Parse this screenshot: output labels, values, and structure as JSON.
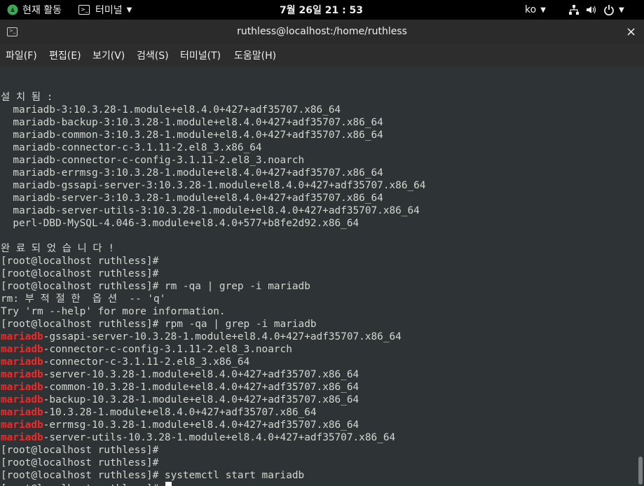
{
  "topbar": {
    "activities": "현재 활동",
    "app_name": "터미널",
    "clock": "7월 26일  21 : 53",
    "language": "ko"
  },
  "window": {
    "title": "ruthless@localhost:/home/ruthless",
    "close": "×"
  },
  "menu": [
    "파일(F)",
    "편집(E)",
    "보기(V)",
    "검색(S)",
    "터미널(T)",
    "도움말(H)"
  ],
  "terminal_lines": [
    {
      "text": ""
    },
    {
      "text": "설 치 됨 :"
    },
    {
      "text": "  mariadb-3:10.3.28-1.module+el8.4.0+427+adf35707.x86_64"
    },
    {
      "text": "  mariadb-backup-3:10.3.28-1.module+el8.4.0+427+adf35707.x86_64"
    },
    {
      "text": "  mariadb-common-3:10.3.28-1.module+el8.4.0+427+adf35707.x86_64"
    },
    {
      "text": "  mariadb-connector-c-3.1.11-2.el8_3.x86_64"
    },
    {
      "text": "  mariadb-connector-c-config-3.1.11-2.el8_3.noarch"
    },
    {
      "text": "  mariadb-errmsg-3:10.3.28-1.module+el8.4.0+427+adf35707.x86_64"
    },
    {
      "text": "  mariadb-gssapi-server-3:10.3.28-1.module+el8.4.0+427+adf35707.x86_64"
    },
    {
      "text": "  mariadb-server-3:10.3.28-1.module+el8.4.0+427+adf35707.x86_64"
    },
    {
      "text": "  mariadb-server-utils-3:10.3.28-1.module+el8.4.0+427+adf35707.x86_64"
    },
    {
      "text": "  perl-DBD-MySQL-4.046-3.module+el8.4.0+577+b8fe2d92.x86_64"
    },
    {
      "text": ""
    },
    {
      "text": "완 료 되 었 습 니 다 !"
    },
    {
      "text": "[root@localhost ruthless]#"
    },
    {
      "text": "[root@localhost ruthless]#"
    },
    {
      "text": "[root@localhost ruthless]# rm -qa | grep -i mariadb"
    },
    {
      "text": "rm: 부 적 절 한  옵 션  -- 'q'"
    },
    {
      "text": "Try 'rm --help' for more information."
    },
    {
      "text": "[root@localhost ruthless]# rpm -qa | grep -i mariadb"
    },
    {
      "hl": "mariadb",
      "text": "-gssapi-server-10.3.28-1.module+el8.4.0+427+adf35707.x86_64"
    },
    {
      "hl": "mariadb",
      "text": "-connector-c-config-3.1.11-2.el8_3.noarch"
    },
    {
      "hl": "mariadb",
      "text": "-connector-c-3.1.11-2.el8_3.x86_64"
    },
    {
      "hl": "mariadb",
      "text": "-server-10.3.28-1.module+el8.4.0+427+adf35707.x86_64"
    },
    {
      "hl": "mariadb",
      "text": "-common-10.3.28-1.module+el8.4.0+427+adf35707.x86_64"
    },
    {
      "hl": "mariadb",
      "text": "-backup-10.3.28-1.module+el8.4.0+427+adf35707.x86_64"
    },
    {
      "hl": "mariadb",
      "text": "-10.3.28-1.module+el8.4.0+427+adf35707.x86_64"
    },
    {
      "hl": "mariadb",
      "text": "-errmsg-10.3.28-1.module+el8.4.0+427+adf35707.x86_64"
    },
    {
      "hl": "mariadb",
      "text": "-server-utils-10.3.28-1.module+el8.4.0+427+adf35707.x86_64"
    },
    {
      "text": "[root@localhost ruthless]#"
    },
    {
      "text": "[root@localhost ruthless]#"
    },
    {
      "text": "[root@localhost ruthless]# systemctl start mariadb"
    },
    {
      "text": "[root@localhost ruthless]# ",
      "cursor": true
    }
  ],
  "colors": {
    "terminal_bg": "#2e3436",
    "terminal_fg": "#d3d7cf",
    "highlight": "#ef2929"
  }
}
